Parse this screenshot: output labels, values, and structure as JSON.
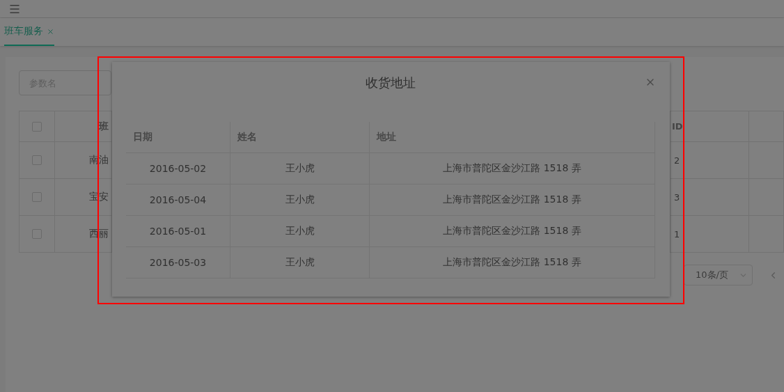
{
  "tabs": [
    {
      "label": "班车服务",
      "selected": true
    }
  ],
  "search": {
    "placeholder": "参数名"
  },
  "table": {
    "all_checked": false,
    "columns": [
      "班",
      "ID"
    ],
    "rows": [
      {
        "checked": false,
        "cells": [
          "南油",
          "2"
        ]
      },
      {
        "checked": false,
        "cells": [
          "宝安",
          "3"
        ]
      },
      {
        "checked": false,
        "cells": [
          "西丽",
          "1"
        ]
      }
    ]
  },
  "pagination": {
    "page_size": "10条/页"
  },
  "dialog": {
    "title": "收货地址",
    "table": {
      "columns": [
        "日期",
        "姓名",
        "地址"
      ],
      "rows": [
        [
          "2016-05-02",
          "王小虎",
          "上海市普陀区金沙江路 1518 弄"
        ],
        [
          "2016-05-04",
          "王小虎",
          "上海市普陀区金沙江路 1518 弄"
        ],
        [
          "2016-05-01",
          "王小虎",
          "上海市普陀区金沙江路 1518 弄"
        ],
        [
          "2016-05-03",
          "王小虎",
          "上海市普陀区金沙江路 1518 弄"
        ]
      ]
    }
  }
}
